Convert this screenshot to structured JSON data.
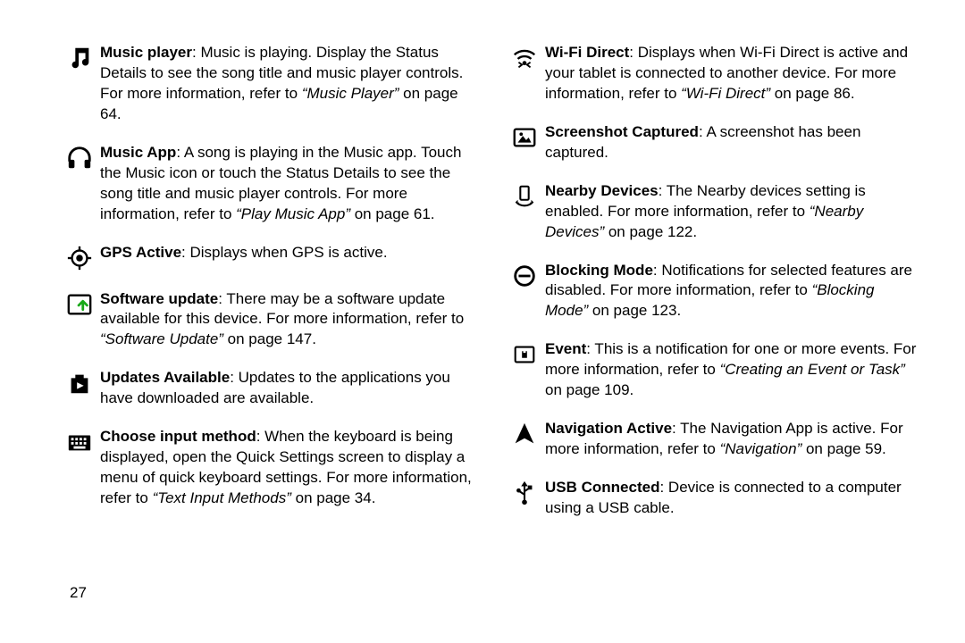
{
  "page_number": "27",
  "left": [
    {
      "icon": "music-note-icon",
      "title": "Music player",
      "body": ": Music is playing. Display the Status Details to see the song title and music player controls. For more information, refer to ",
      "ref": "“Music Player”",
      "tail": " on page 64."
    },
    {
      "icon": "headphones-icon",
      "title": "Music App",
      "body": ": A song is playing in the Music app. Touch the Music icon or touch the Status Details to see the song title and music player controls. For more information, refer to ",
      "ref": "“Play Music App”",
      "tail": " on page 61."
    },
    {
      "icon": "gps-icon",
      "title": "GPS Active",
      "body": ": Displays when GPS is active.",
      "ref": "",
      "tail": ""
    },
    {
      "icon": "software-update-icon",
      "title": "Software update",
      "body": ": There may be a software update available for this device. For more information, refer to ",
      "ref": "“Software Update”",
      "tail": " on page 147."
    },
    {
      "icon": "updates-available-icon",
      "title": "Updates Available",
      "body": ": Updates to the applications you have downloaded are available.",
      "ref": "",
      "tail": ""
    },
    {
      "icon": "keyboard-icon",
      "title": "Choose input method",
      "body": ": When the keyboard is being displayed, open the Quick Settings screen to display a menu of quick keyboard settings. For more information, refer to ",
      "ref": "“Text Input Methods”",
      "tail": " on page 34."
    }
  ],
  "right": [
    {
      "icon": "wifi-direct-icon",
      "title": "Wi-Fi Direct",
      "body": ": Displays when Wi-Fi Direct is active and your tablet is connected to another device. For more information, refer to ",
      "ref": "“Wi-Fi Direct”",
      "tail": " on page 86."
    },
    {
      "icon": "screenshot-icon",
      "title": "Screenshot Captured",
      "body": ": A screenshot has been captured.",
      "ref": "",
      "tail": ""
    },
    {
      "icon": "nearby-devices-icon",
      "title": "Nearby Devices",
      "body": ": The Nearby devices setting is enabled. For more information, refer to ",
      "ref": "“Nearby Devices”",
      "tail": " on page 122."
    },
    {
      "icon": "blocking-mode-icon",
      "title": "Blocking Mode",
      "body": ": Notifications for selected features are disabled. For more information, refer to ",
      "ref": "“Blocking Mode”",
      "tail": " on page 123."
    },
    {
      "icon": "event-icon",
      "title": "Event",
      "body": ": This is a notification for one or more events. For more information, refer to ",
      "ref": "“Creating an Event or Task”",
      "tail": " on page 109."
    },
    {
      "icon": "navigation-icon",
      "title": "Navigation Active",
      "body": ": The Navigation App is active. For more information, refer to ",
      "ref": "“Navigation”",
      "tail": " on page 59."
    },
    {
      "icon": "usb-icon",
      "title": "USB Connected",
      "body": ": Device is connected to a computer using a USB cable.",
      "ref": "",
      "tail": ""
    }
  ]
}
